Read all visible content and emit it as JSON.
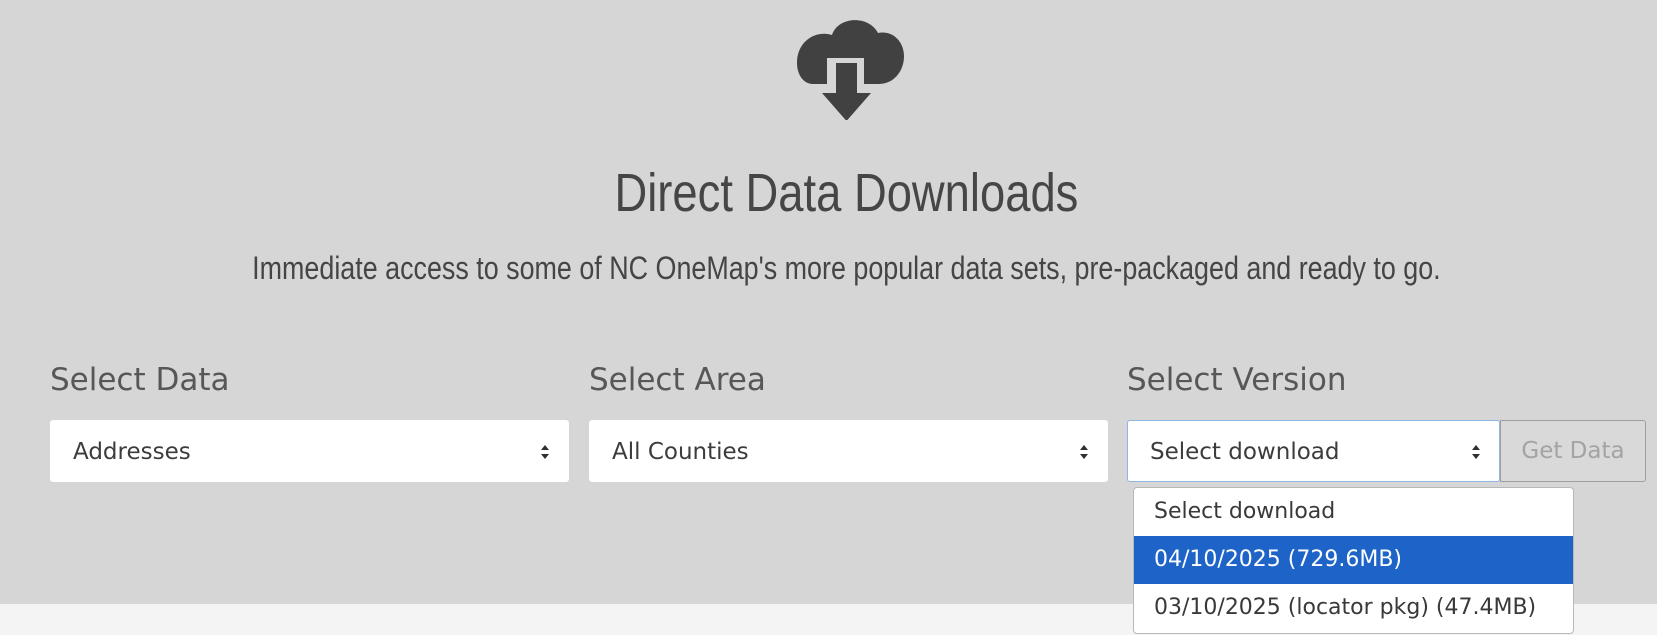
{
  "header": {
    "icon": "cloud-download-icon",
    "title": "Direct Data Downloads",
    "subtitle": "Immediate access to some of NC OneMap's more popular data sets, pre-packaged and ready to go."
  },
  "form": {
    "data": {
      "label": "Select Data",
      "value": "Addresses"
    },
    "area": {
      "label": "Select Area",
      "value": "All Counties"
    },
    "version": {
      "label": "Select Version",
      "value": "Select download",
      "options": [
        "Select download",
        "04/10/2025 (729.6MB)",
        "03/10/2025 (locator pkg) (47.4MB)"
      ],
      "highlighted_option": "04/10/2025 (729.6MB)"
    },
    "get_data_label": "Get Data"
  },
  "colors": {
    "background": "#d6d6d6",
    "text": "#464646",
    "option_highlight": "#1e64c8",
    "focus_border": "#8fb6e6"
  }
}
